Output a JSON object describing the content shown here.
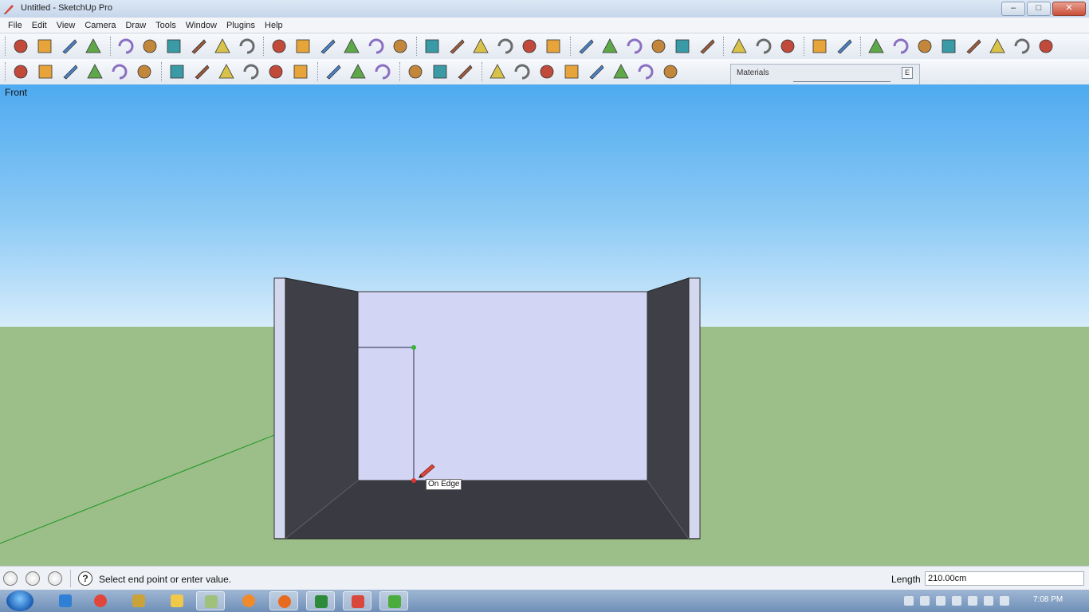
{
  "window": {
    "title": "Untitled - SketchUp Pro",
    "minimize": "–",
    "maximize": "□",
    "close": "✕"
  },
  "menu": [
    "File",
    "Edit",
    "View",
    "Camera",
    "Draw",
    "Tools",
    "Window",
    "Plugins",
    "Help"
  ],
  "toolbar1": [
    "select-icon",
    "make-component-icon",
    "paint-bucket-icon",
    "eraser-icon",
    "rectangle-icon",
    "line-icon",
    "circle-icon",
    "arc-icon",
    "polygon-icon",
    "freehand-icon",
    "move-icon",
    "push-pull-icon",
    "rotate-icon",
    "follow-me-icon",
    "scale-icon",
    "offset-icon",
    "tape-measure-icon",
    "dimension-icon",
    "protractor-icon",
    "text-icon",
    "axes-icon",
    "3d-text-icon",
    "orbit-icon",
    "pan-icon",
    "zoom-icon",
    "zoom-window-icon",
    "zoom-extents-icon",
    "previous-view-icon",
    "position-camera-icon",
    "look-around-icon",
    "walk-icon",
    "section-plane-icon",
    "sandbox-icon",
    "stamp-icon",
    "drape-icon",
    "add-detail-icon",
    "flip-edge-icon",
    "smoove-icon",
    "from-contours-icon",
    "from-scratch-icon",
    "add-location-icon"
  ],
  "toolbar2": [
    "iso-view-icon",
    "top-view-icon",
    "front-view-icon",
    "right-view-icon",
    "back-view-icon",
    "left-view-icon",
    "xray-icon",
    "wireframe-icon",
    "hidden-line-icon",
    "shaded-icon",
    "shaded-textures-icon",
    "monochrome-icon",
    "display-section-icon",
    "section-cuts-icon",
    "section-fill-icon",
    "3d-warehouse-icon",
    "share-model-icon",
    "get-models-icon",
    "google-earth-icon",
    "dynamic-component-icon",
    "sphere-icon",
    "intersect-icon",
    "outer-shell-icon",
    "subtract-icon",
    "material-ball-icon",
    "solid-tools-icon"
  ],
  "materials": {
    "title": "Materials",
    "close": "E"
  },
  "viewport": {
    "view_label": "Front",
    "tooltip": "On Edge"
  },
  "status": {
    "prompt": "Select end point or enter value.",
    "length_label": "Length",
    "length_value": "210.00cm",
    "help": "?"
  },
  "taskbar": {
    "clock": "7:08 PM",
    "apps": [
      "ie-icon",
      "chrome-icon",
      "network-icon",
      "folder-icon",
      "explorer-icon",
      "media-player-icon",
      "firefox-icon",
      "excel-icon",
      "sketchup-icon",
      "camtasia-icon"
    ]
  }
}
